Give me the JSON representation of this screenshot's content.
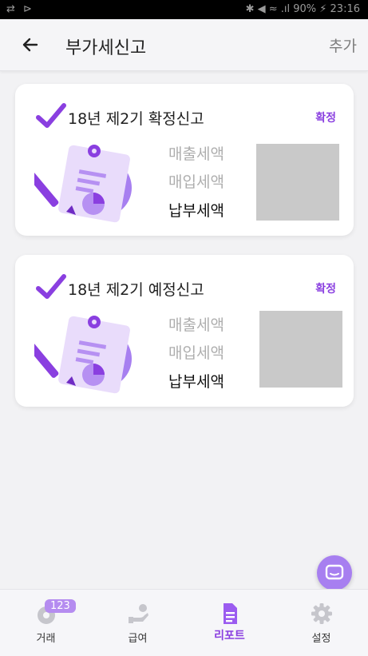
{
  "status_bar": {
    "left_icons": "⇄ ⊳",
    "right_text": "✱ ◀ ≈ .ıl 90% ⚡ 23:16"
  },
  "header": {
    "title": "부가세신고",
    "action": "추가"
  },
  "cards": [
    {
      "title": "18년 제2기 확정신고",
      "status": "확정",
      "labels": [
        "매출세액",
        "매입세액",
        "납부세액"
      ]
    },
    {
      "title": "18년 제2기 예정신고",
      "status": "확정",
      "labels": [
        "매출세액",
        "매입세액",
        "납부세액"
      ]
    }
  ],
  "nav": {
    "items": [
      {
        "label": "거래",
        "icon": "gear-icon",
        "badge": "123"
      },
      {
        "label": "급여",
        "icon": "hand-money-icon"
      },
      {
        "label": "리포트",
        "icon": "document-icon"
      },
      {
        "label": "설정",
        "icon": "gear-icon"
      }
    ],
    "active": "리포트"
  },
  "colors": {
    "accent": "#8a3fe0",
    "fab": "#a77ff0",
    "placeholder": "#c9c9c9"
  }
}
